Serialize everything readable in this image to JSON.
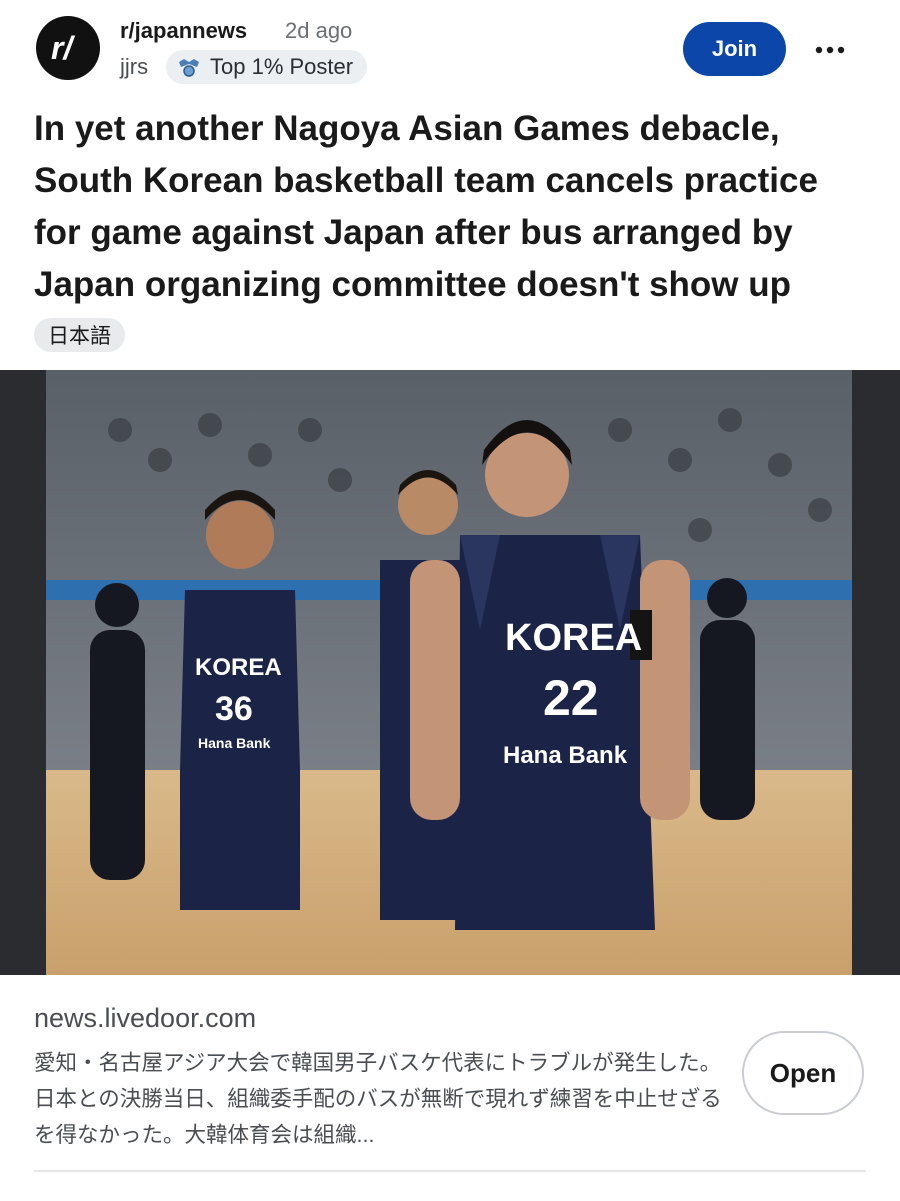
{
  "post": {
    "subreddit": "r/japannews",
    "time": "2d ago",
    "author": "jjrs",
    "flair": "Top 1% Poster",
    "join_label": "Join",
    "title": "In yet another Nagoya Asian Games debacle, South Korean basketball team cancels practice for game against Japan after bus arranged by Japan organizing committee doesn't show up",
    "language_tag": "日本語"
  },
  "photo": {
    "jerseys": [
      {
        "team": "KOREA",
        "number": "22",
        "sponsor": "Hana Bank"
      },
      {
        "team": "KOREA",
        "number": "36",
        "sponsor": "Hana Bank"
      },
      {
        "team": "KOREA",
        "number": "",
        "sponsor": ""
      }
    ]
  },
  "link": {
    "domain": "news.livedoor.com",
    "excerpt": "愛知・名古屋アジア大会で韓国男子バスケ代表にトラブルが発生した。日本との決勝当日、組織委手配のバスが無断で現れず練習を中止せざるを得なかった。大韓体育会は組織...",
    "open_label": "Open"
  },
  "colors": {
    "join_button": "#0b46a8",
    "jersey": "#1b2447",
    "background": "#ffffff"
  },
  "icons": [
    "subreddit-avatar-icon",
    "flair-badge-icon",
    "more-options-icon"
  ]
}
